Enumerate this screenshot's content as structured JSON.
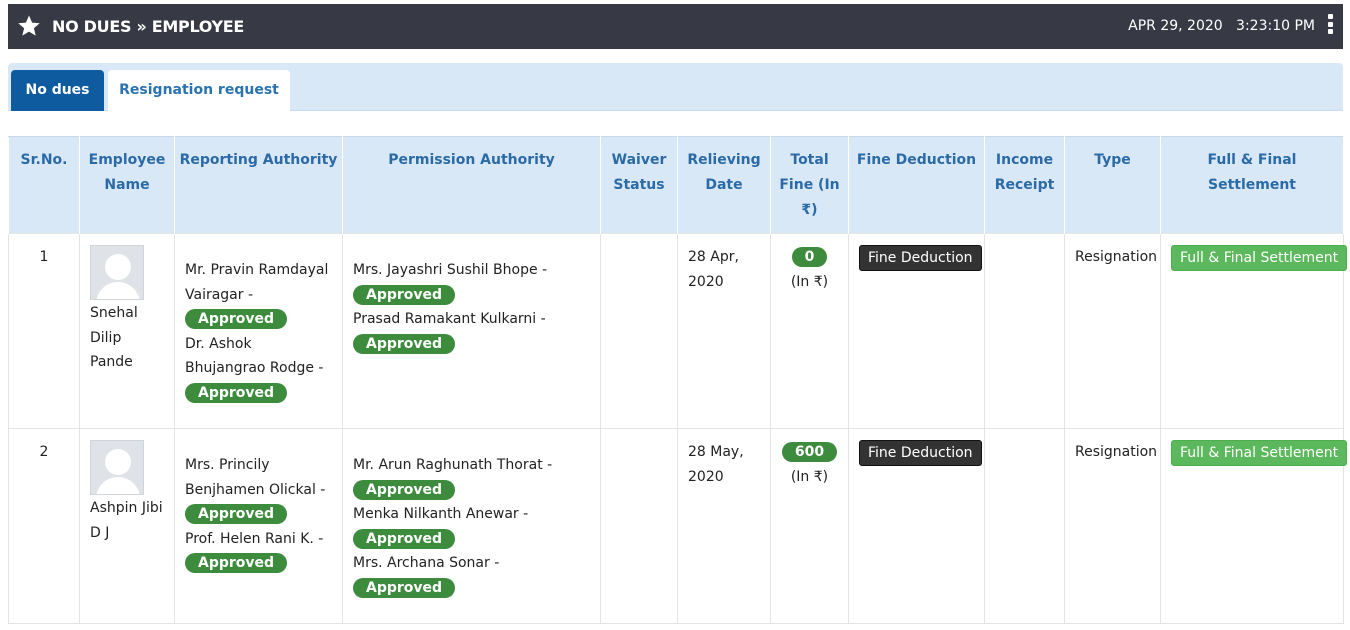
{
  "header": {
    "title": "NO DUES » EMPLOYEE",
    "date": "APR 29, 2020",
    "time": "3:23:10 PM"
  },
  "tabs": [
    {
      "label": "No dues",
      "active": true
    },
    {
      "label": "Resignation request",
      "active": false
    }
  ],
  "table": {
    "columns": [
      "Sr.No.",
      "Employee Name",
      "Reporting Authority",
      "Permission Authority",
      "Waiver Status",
      "Relieving Date",
      "Total Fine (In ₹)",
      "Fine Deduction",
      "Income Receipt",
      "Type",
      "Full & Final Settlement"
    ],
    "rows": [
      {
        "sr": "1",
        "employee": "Snehal Dilip Pande",
        "reporting": [
          {
            "name": "Mr. Pravin Ramdayal Vairagar -",
            "status": "Approved"
          },
          {
            "name": "Dr. Ashok Bhujangrao Rodge -",
            "status": "Approved"
          }
        ],
        "permission": [
          {
            "name": "Mrs. Jayashri Sushil Bhope -",
            "status": "Approved"
          },
          {
            "name": "Prasad Ramakant Kulkarni -",
            "status": "Approved"
          }
        ],
        "waiver": "",
        "relieving_date": "28 Apr, 2020",
        "fine": "0",
        "fine_unit": "(In ₹)",
        "fine_deduction_label": "Fine Deduction",
        "income_receipt": "",
        "type": "Resignation",
        "settlement_label": "Full & Final Settlement"
      },
      {
        "sr": "2",
        "employee": "Ashpin Jibi D J",
        "reporting": [
          {
            "name": "Mrs. Princily Benjhamen Olickal -",
            "status": "Approved"
          },
          {
            "name": "Prof. Helen Rani K. -",
            "status": "Approved"
          }
        ],
        "permission": [
          {
            "name": "Mr. Arun Raghunath Thorat -",
            "status": "Approved"
          },
          {
            "name": "Menka Nilkanth Anewar -",
            "status": "Approved"
          },
          {
            "name": "Mrs. Archana Sonar -",
            "status": "Approved"
          }
        ],
        "waiver": "",
        "relieving_date": "28 May, 2020",
        "fine": "600",
        "fine_unit": "(In ₹)",
        "fine_deduction_label": "Fine Deduction",
        "income_receipt": "",
        "type": "Resignation",
        "settlement_label": "Full & Final Settlement"
      }
    ]
  },
  "colors": {
    "topbar": "#373a45",
    "active_tab": "#0e5b9f",
    "header_bg": "#d9e8f7",
    "header_text": "#2a6aa7",
    "approved_badge": "#3d8b3d",
    "settlement_button": "#5cb85c",
    "fine_button": "#333333"
  },
  "icons": {
    "title_icon": "star-icon",
    "menu_icon": "kebab-menu-icon",
    "avatar_icon": "user-placeholder-icon"
  }
}
